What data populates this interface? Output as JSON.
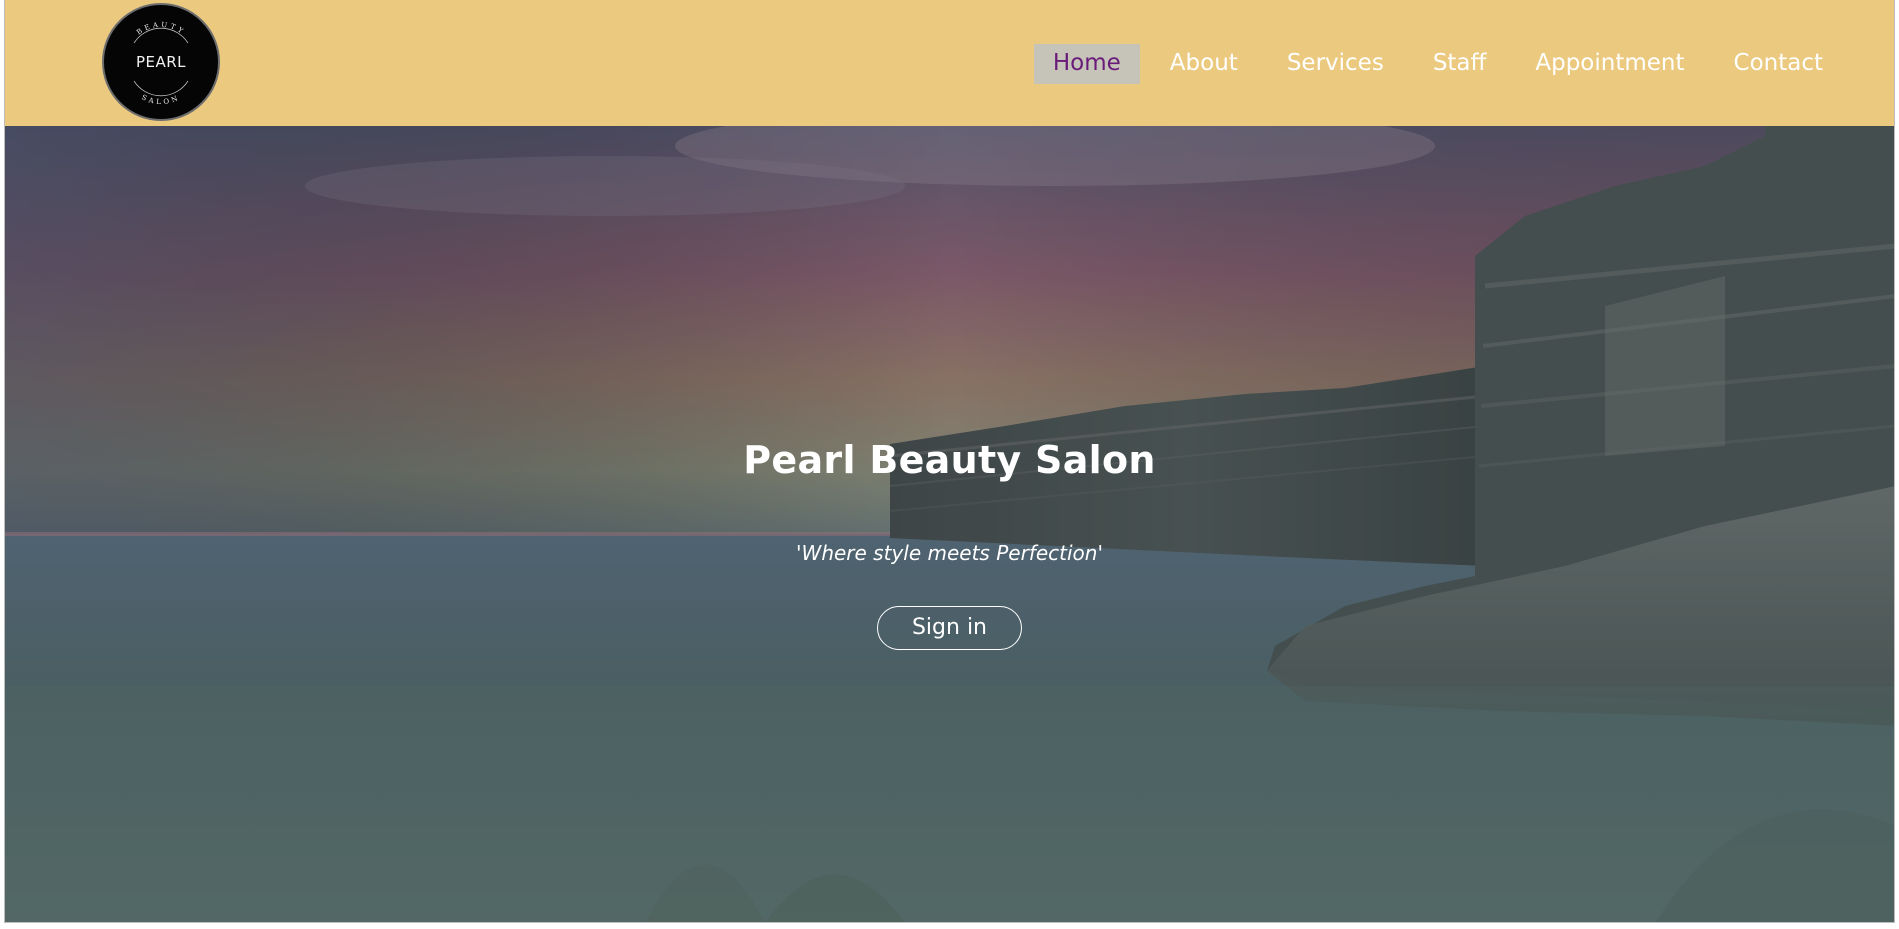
{
  "logo": {
    "text": "PEARL",
    "top_arc_text": "BEAUTY",
    "bottom_arc_text": "SALON",
    "icon": "pearl-logo-icon"
  },
  "nav": {
    "items": [
      {
        "label": "Home",
        "active": true
      },
      {
        "label": "About"
      },
      {
        "label": "Services"
      },
      {
        "label": "Staff"
      },
      {
        "label": "Appointment"
      },
      {
        "label": "Contact"
      }
    ]
  },
  "hero": {
    "title": "Pearl Beauty Salon",
    "tagline": "'Where style meets Perfection'",
    "signin_label": "Sign in"
  },
  "colors": {
    "header_bg": "#ebc97f",
    "nav_active_bg": "#c6c3b8",
    "nav_active_text": "#6a1b7a",
    "nav_text": "#ffffff"
  }
}
